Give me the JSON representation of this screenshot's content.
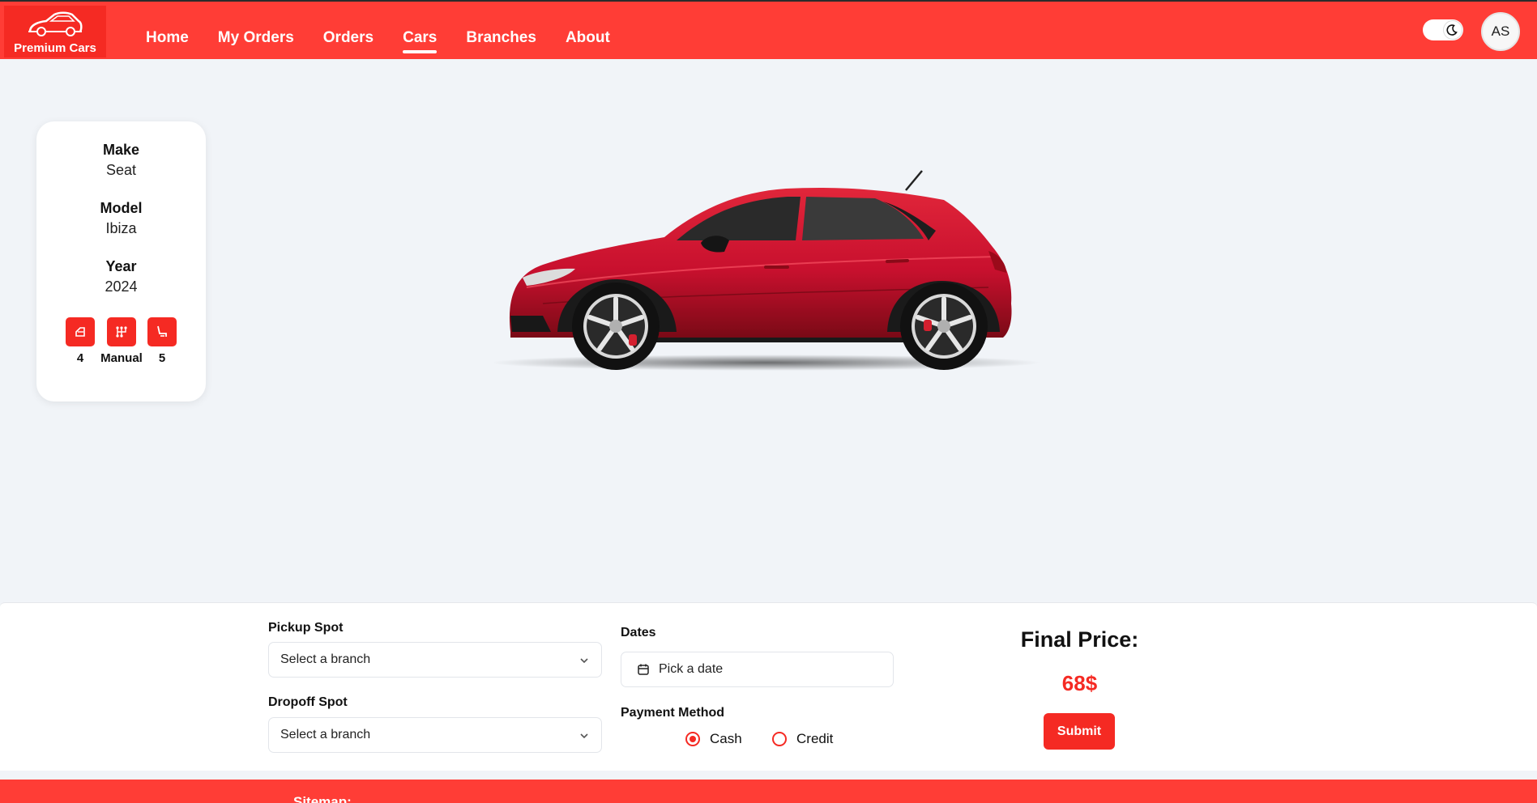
{
  "brand": {
    "name": "Premium Cars",
    "accent": "#f52a23",
    "nav_bg": "#ff3d36"
  },
  "nav": {
    "links": [
      {
        "label": "Home"
      },
      {
        "label": "My Orders"
      },
      {
        "label": "Orders"
      },
      {
        "label": "Cars",
        "active": true
      },
      {
        "label": "Branches"
      },
      {
        "label": "About"
      }
    ],
    "theme_icon": "moon-icon",
    "avatar_initials": "AS"
  },
  "car": {
    "make_label": "Make",
    "make": "Seat",
    "model_label": "Model",
    "model": "Ibiza",
    "year_label": "Year",
    "year": "2024",
    "features": [
      {
        "icon": "door-icon",
        "value": "4"
      },
      {
        "icon": "gearbox-icon",
        "value": "Manual"
      },
      {
        "icon": "seat-icon",
        "value": "5"
      }
    ],
    "image_icon": "car-image",
    "body_color": "#c8102e"
  },
  "booking": {
    "pickup_label": "Pickup Spot",
    "pickup_value": "Select a branch",
    "dropoff_label": "Dropoff Spot",
    "dropoff_value": "Select a branch",
    "dates_label": "Dates",
    "dates_value": "Pick a date",
    "payment_label": "Payment Method",
    "payment_options": [
      {
        "label": "Cash",
        "checked": true
      },
      {
        "label": "Credit",
        "checked": false
      }
    ],
    "price_title": "Final Price:",
    "price_value": "68$",
    "submit_label": "Submit"
  },
  "footer": {
    "heading": "Sitemap:"
  }
}
